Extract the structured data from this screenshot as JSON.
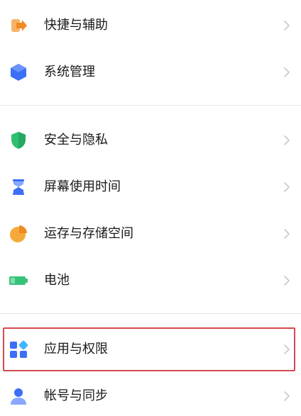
{
  "settings": {
    "items": [
      {
        "label": "快捷与辅助",
        "icon": "shortcut-arrow-icon"
      },
      {
        "label": "系统管理",
        "icon": "system-hexagon-icon"
      },
      {
        "label": "安全与隐私",
        "icon": "shield-icon"
      },
      {
        "label": "屏幕使用时间",
        "icon": "hourglass-icon"
      },
      {
        "label": "运存与存储空间",
        "icon": "storage-pie-icon"
      },
      {
        "label": "电池",
        "icon": "battery-icon"
      },
      {
        "label": "应用与权限",
        "icon": "apps-grid-icon"
      },
      {
        "label": "帐号与同步",
        "icon": "account-person-icon"
      }
    ],
    "highlight_color": "#d44a4f"
  }
}
